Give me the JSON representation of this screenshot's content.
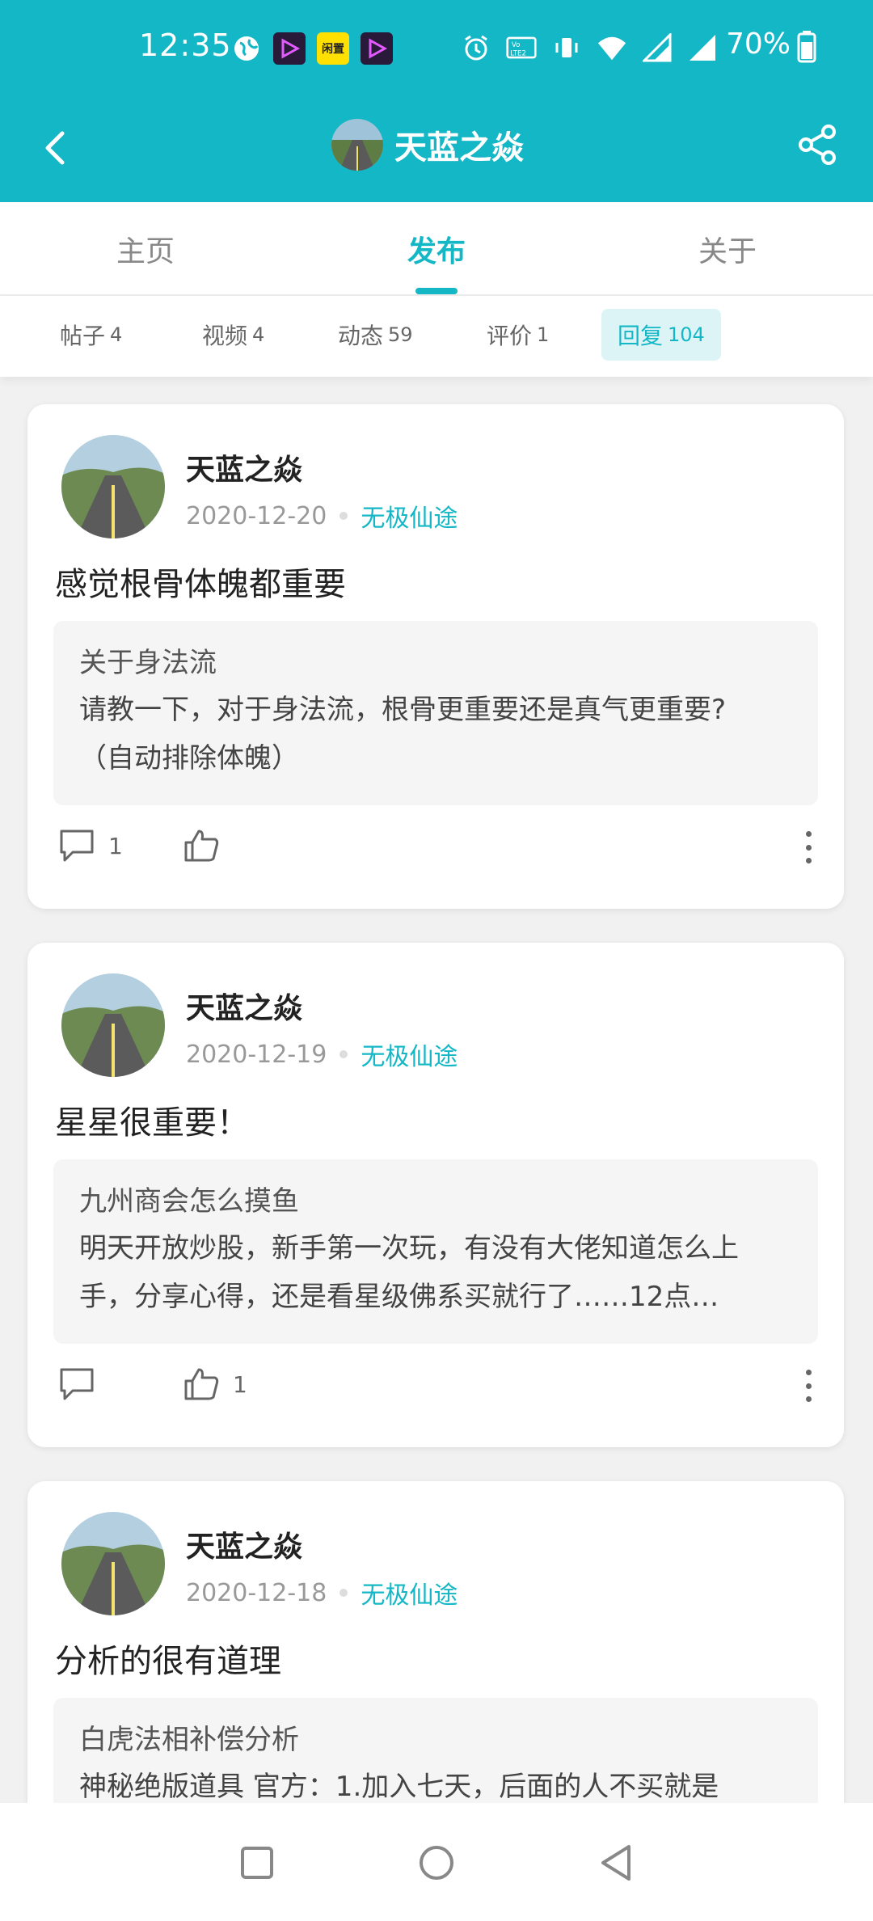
{
  "status_bar": {
    "time": "12:35",
    "battery": "70%",
    "app_badge": "闲置",
    "volte": "Vo⁰ LTE2"
  },
  "nav": {
    "title": "天蓝之焱",
    "back_icon": "back-arrow",
    "share_icon": "share"
  },
  "tabs": [
    {
      "label": "主页",
      "active": false
    },
    {
      "label": "发布",
      "active": true
    },
    {
      "label": "关于",
      "active": false
    }
  ],
  "subtabs": [
    {
      "label": "帖子",
      "count": "4",
      "active": false
    },
    {
      "label": "视频",
      "count": "4",
      "active": false
    },
    {
      "label": "动态",
      "count": "59",
      "active": false
    },
    {
      "label": "评价",
      "count": "1",
      "active": false
    },
    {
      "label": "回复",
      "count": "104",
      "active": true
    }
  ],
  "posts": [
    {
      "author": "天蓝之焱",
      "date": "2020-12-20",
      "tag": "无极仙途",
      "text": "感觉根骨体魄都重要",
      "quote_title": "关于身法流",
      "quote_line1": "请教一下，对于身法流，根骨更重要还是真气更重要?",
      "quote_line2": "（自动排除体魄）",
      "comments": "1",
      "likes": ""
    },
    {
      "author": "天蓝之焱",
      "date": "2020-12-19",
      "tag": "无极仙途",
      "text": "星星很重要！",
      "quote_title": "九州商会怎么摸鱼",
      "quote_line1": "明天开放炒股，新手第一次玩，有没有大佬知道怎么上",
      "quote_line2": "手，分享心得，还是看星级佛系买就行了……12点…",
      "comments": "",
      "likes": "1"
    },
    {
      "author": "天蓝之焱",
      "date": "2020-12-18",
      "tag": "无极仙途",
      "text": "分析的很有道理",
      "quote_title": "白虎法相补偿分析",
      "quote_line1": "神秘绝版道具 官方：1.加入七天，后面的人不买就是",
      "quote_line2": "",
      "comments": "",
      "likes": ""
    }
  ],
  "colors": {
    "accent": "#14b7c6",
    "tab_active_bg": "#ddf4f6",
    "background": "#f1f1f1"
  }
}
